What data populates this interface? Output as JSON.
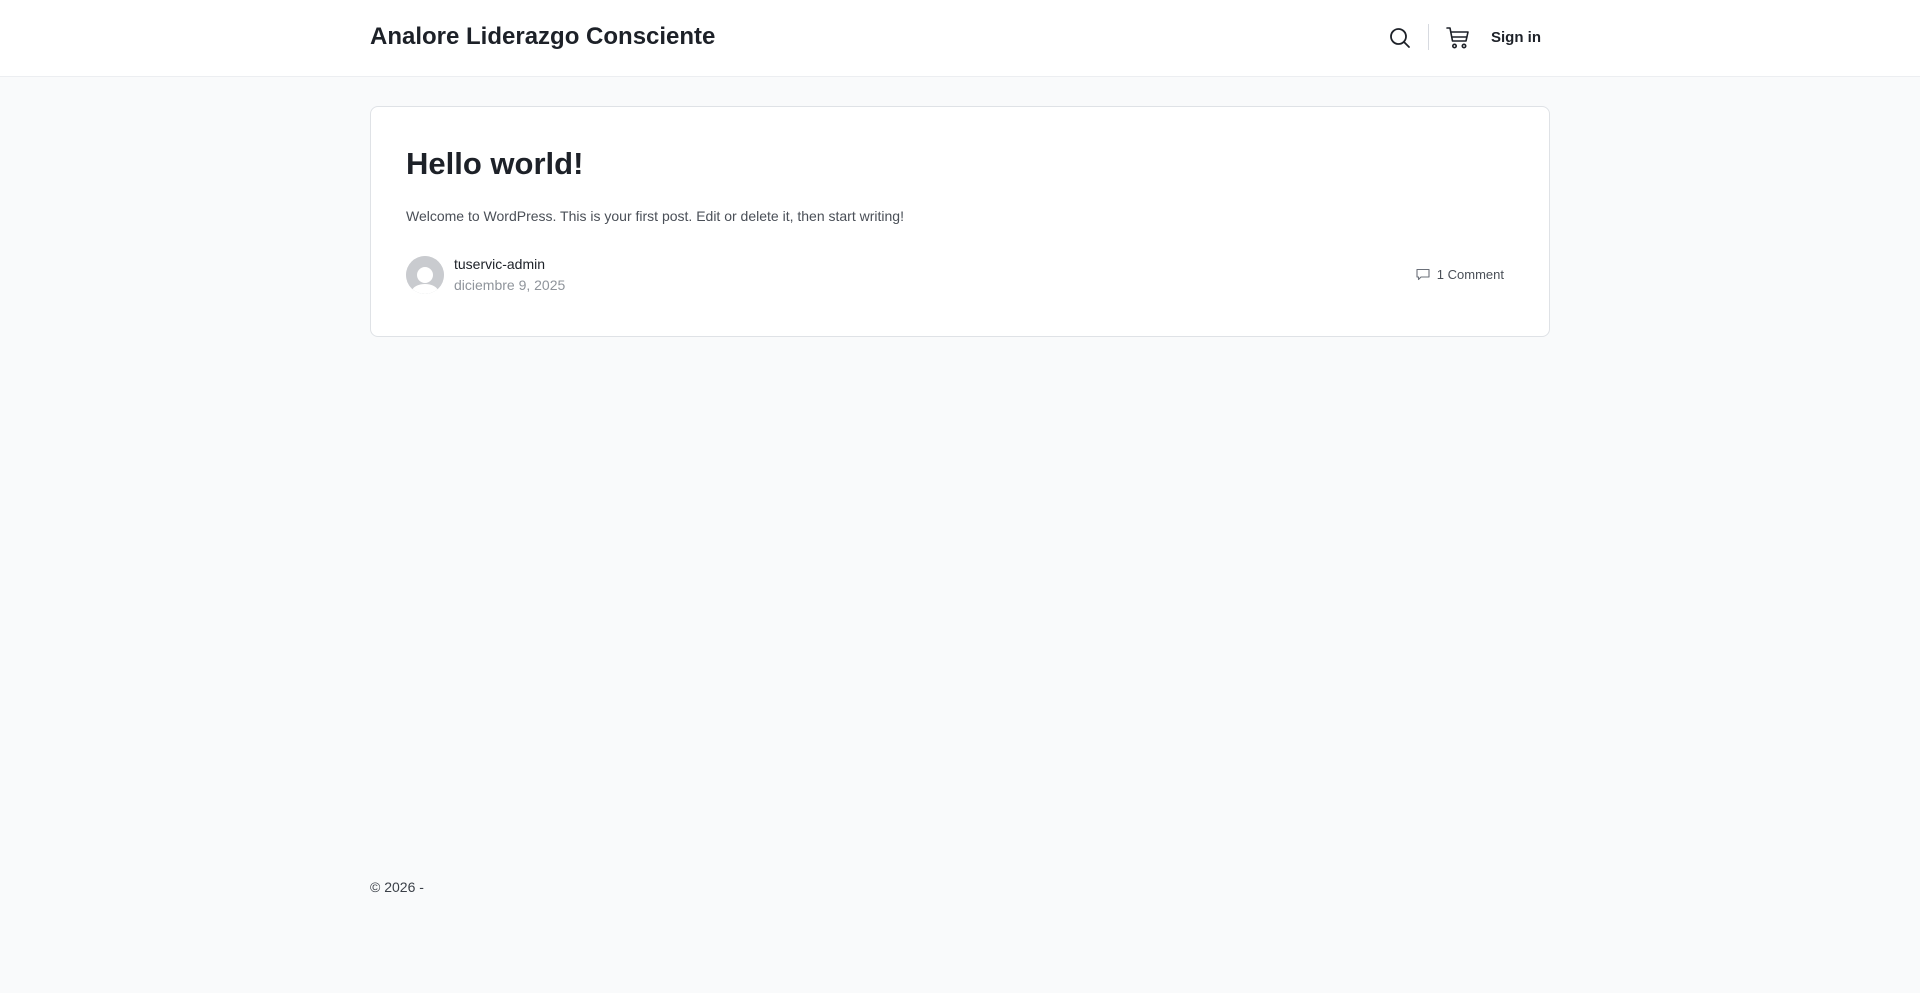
{
  "header": {
    "site_title": "Analore Liderazgo Consciente",
    "search_icon": "search-icon",
    "cart_icon": "cart-icon",
    "signin_label": "Sign in"
  },
  "post": {
    "title": "Hello world!",
    "excerpt": "Welcome to WordPress. This is your first post. Edit or delete it, then start writing!",
    "author": "tuservic-admin",
    "date": "diciembre 9, 2025",
    "comments_label": "1 Comment",
    "comment_icon": "comment-icon",
    "avatar_icon": "avatar-icon"
  },
  "footer": {
    "copyright": "© 2026 -"
  },
  "colors": {
    "page_background": "#f9fafb",
    "card_background": "#ffffff",
    "text_primary": "#1d2128",
    "text_muted": "#8f949b",
    "border": "#dfe2e6"
  }
}
